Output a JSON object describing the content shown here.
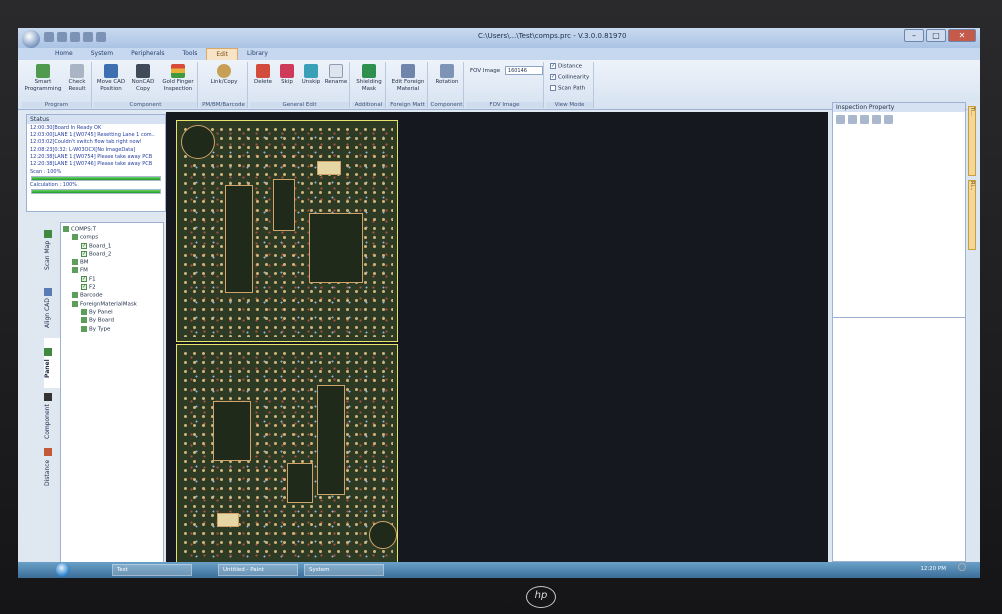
{
  "window": {
    "title": "C:\\Users\\...\\Test\\comps.prc - V.3.0.0.81970",
    "controls": [
      "–",
      "□",
      "✕"
    ]
  },
  "ribbon": {
    "tabs": [
      "Home",
      "System",
      "Peripherals",
      "Tools",
      "Edit",
      "Library"
    ],
    "active_tab": "Edit",
    "groups": [
      {
        "label": "Program",
        "buttons": [
          "Smart Programming",
          "Check Result"
        ]
      },
      {
        "label": "Component",
        "buttons": [
          "Move CAD Position",
          "NonCAD Copy",
          "Gold Finger Inspection"
        ]
      },
      {
        "label": "PM/BM/Barcode",
        "buttons": [
          "Link/Copy"
        ]
      },
      {
        "label": "General Edit",
        "buttons": [
          "Delete",
          "Skip",
          "Unskip",
          "Rename"
        ]
      },
      {
        "label": "Additional",
        "buttons": [
          "Shielding Mask"
        ]
      },
      {
        "label": "Foreign Matt",
        "buttons": [
          "Edit Foreign Material"
        ]
      },
      {
        "label": "Component",
        "buttons": [
          "Rotation"
        ]
      }
    ],
    "fov": {
      "label": "FOV Image",
      "value": "160146",
      "group_label": "FOV Image"
    },
    "view_mode": {
      "group_label": "View Mode",
      "options": [
        {
          "label": "Distance",
          "checked": true
        },
        {
          "label": "Collinearity",
          "checked": true
        },
        {
          "label": "Scan Path",
          "checked": false
        }
      ]
    }
  },
  "status_panel": {
    "title": "Status",
    "log": [
      "12:00:30[Board In Ready OK",
      "12:03:00[LANE 1:[W0745] Resetting Lane 1 com..",
      "12:03:02[Couldn't switch flow tab right now!",
      "12:08:23[0:32: L-W03OCX[No ImageData]",
      "12:20:38[LANE 1:[W0754] Please take away PCB",
      "12:20:38[LANE 1:[W0746] Please take away PCB"
    ],
    "scan_label": "Scan : 100%",
    "scan_progress": 1.0,
    "calc_label": "Calculation : 100%",
    "calc_progress": 1.0
  },
  "side_tabs": [
    "Scan Map",
    "Align CAD",
    "Panel",
    "Component",
    "Distance"
  ],
  "tree": [
    {
      "label": "COMPS:T",
      "level": 0,
      "kind": "box"
    },
    {
      "label": "comps",
      "level": 1,
      "kind": "box"
    },
    {
      "label": "Board_1",
      "level": 2,
      "kind": "check"
    },
    {
      "label": "Board_2",
      "level": 2,
      "kind": "check"
    },
    {
      "label": "BM",
      "level": 1,
      "kind": "box"
    },
    {
      "label": "FM",
      "level": 1,
      "kind": "box"
    },
    {
      "label": "F1",
      "level": 2,
      "kind": "check"
    },
    {
      "label": "F2",
      "level": 2,
      "kind": "check"
    },
    {
      "label": "Barcode",
      "level": 1,
      "kind": "box"
    },
    {
      "label": "ForeignMaterialMask",
      "level": 1,
      "kind": "box"
    },
    {
      "label": "By Panel",
      "level": 2,
      "kind": "box"
    },
    {
      "label": "By Board",
      "level": 2,
      "kind": "box"
    },
    {
      "label": "By Type",
      "level": 2,
      "kind": "box"
    }
  ],
  "inspection_panel": {
    "title": "Inspection Property"
  },
  "right_dock_tabs": [
    "Ti...",
    "Ri..."
  ],
  "taskbar": {
    "items": [
      "Test",
      "Untitled - Paint",
      "System"
    ],
    "clock": "12:20 PM"
  },
  "monitor_brand": "hp"
}
